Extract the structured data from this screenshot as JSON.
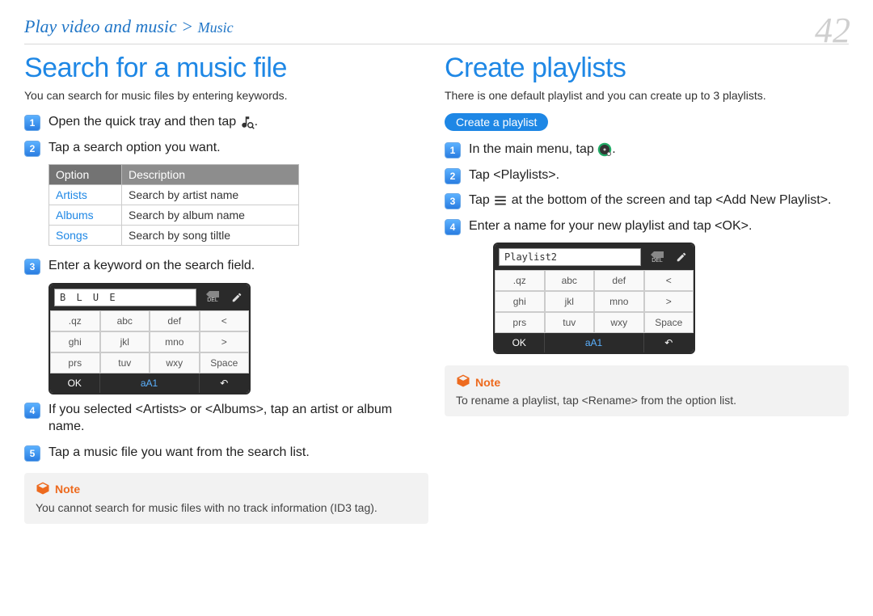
{
  "breadcrumb": {
    "main": "Play video and music >",
    "sub": "Music"
  },
  "page_number": "42",
  "left": {
    "title": "Search for a music file",
    "intro": "You can search for music files by entering keywords.",
    "steps": {
      "s1a": "Open the quick tray and then tap ",
      "s1b": ".",
      "s2": "Tap a search option you want.",
      "s3": "Enter a keyword on the search field.",
      "s4": "If you selected <Artists> or <Albums>, tap an artist or album name.",
      "s5": "Tap a music file you want from the search list."
    },
    "table": {
      "head_option": "Option",
      "head_desc": "Description",
      "rows": [
        {
          "opt": "Artists",
          "desc": "Search by artist name"
        },
        {
          "opt": "Albums",
          "desc": "Search by album name"
        },
        {
          "opt": "Songs",
          "desc": "Search by song tiltle"
        }
      ]
    },
    "keypad": {
      "input": "B L U E",
      "del": "DEL",
      "keys": [
        ".qz",
        "abc",
        "def",
        "<",
        "ghi",
        "jkl",
        "mno",
        ">",
        "prs",
        "tuv",
        "wxy",
        "Space"
      ],
      "ok": "OK",
      "mode": "aA1",
      "back": "↶"
    },
    "note": {
      "label": "Note",
      "text": "You cannot search for music files with no track information (ID3 tag)."
    }
  },
  "right": {
    "title": "Create playlists",
    "intro": "There is one default playlist and you can create up to 3 playlists.",
    "subhead": "Create a playlist",
    "steps": {
      "s1a": "In the main menu, tap ",
      "s1b": ".",
      "s2": "Tap <Playlists>.",
      "s3a": "Tap ",
      "s3b": " at the bottom of the screen and tap <Add New Playlist>.",
      "s4": "Enter a name for your new playlist and tap <OK>."
    },
    "keypad": {
      "input": "Playlist2",
      "del": "DEL",
      "keys": [
        ".qz",
        "abc",
        "def",
        "<",
        "ghi",
        "jkl",
        "mno",
        ">",
        "prs",
        "tuv",
        "wxy",
        "Space"
      ],
      "ok": "OK",
      "mode": "aA1",
      "back": "↶"
    },
    "note": {
      "label": "Note",
      "text": "To rename a playlist, tap <Rename> from the option list."
    }
  }
}
